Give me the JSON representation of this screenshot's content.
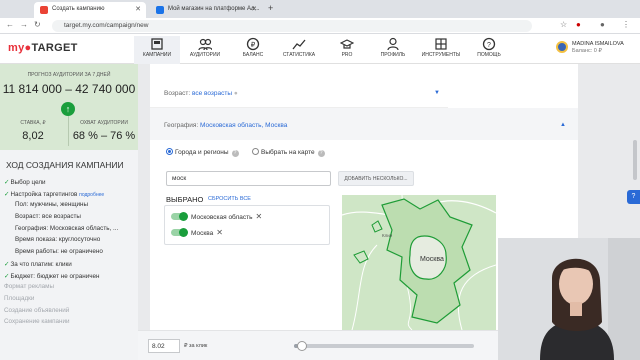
{
  "browser": {
    "tabs": [
      {
        "title": "Создать кампанию",
        "favicon_color": "#ea4335"
      },
      {
        "title": "Мой магазин на платформе Ал...",
        "favicon_color": "#1a73e8"
      }
    ],
    "new_tab": "+",
    "url": "target.my.com/campaign/new"
  },
  "app": {
    "logo_my": "my",
    "logo_target": "TARGET",
    "nav": [
      {
        "label": "КАМПАНИИ",
        "icon": "campaigns-icon",
        "active": true
      },
      {
        "label": "АУДИТОРИИ",
        "icon": "audiences-icon"
      },
      {
        "label": "БАЛАНС",
        "icon": "balance-icon"
      },
      {
        "label": "СТАТИСТИКА",
        "icon": "statistics-icon"
      },
      {
        "label": "PRO",
        "icon": "pro-icon"
      },
      {
        "label": "ПРОФИЛЬ",
        "icon": "profile-icon"
      },
      {
        "label": "ИНСТРУМЕНТЫ",
        "icon": "tools-icon"
      },
      {
        "label": "ПОМОЩЬ",
        "icon": "help-icon"
      }
    ],
    "user": {
      "name": "MADINA ISMAILOVA",
      "balance": "Баланс: 0 ₽"
    }
  },
  "forecast": {
    "heading": "ПРОГНОЗ АУДИТОРИИ ЗА 7 ДНЕЙ",
    "range": "11 814 000 – 42 740 000",
    "stavka_label": "СТАВКА, ₽",
    "stavka_value": "8,02",
    "ohvat_label": "ОХВАТ АУДИТОРИИ",
    "ohvat_value": "68 % – 76 %"
  },
  "steps": {
    "title": "ХОД СОЗДАНИЯ КАМПАНИИ",
    "items": [
      {
        "text": "Выбор цели",
        "done": true
      },
      {
        "text": "Настройка таргетингов",
        "done": true,
        "hint": "подробнее"
      },
      {
        "text": "Пол: мужчины, женщины",
        "sub": true
      },
      {
        "text": "Возраст: все возрасты",
        "sub": true
      },
      {
        "text": "География: Московская область, ...",
        "sub": true
      },
      {
        "text": "Время показа: круглосуточно",
        "sub": true
      },
      {
        "text": "Время работы: не ограничено",
        "sub": true
      },
      {
        "text": "За что платим: клики",
        "done": true
      },
      {
        "text": "Бюджет: бюджет не ограничен",
        "done": true
      },
      {
        "text": "Формат рекламы",
        "muted": true
      },
      {
        "text": "Площадки",
        "muted": true
      },
      {
        "text": "Создание объявлений",
        "muted": true
      },
      {
        "text": "Сохранение кампании",
        "muted": true
      }
    ]
  },
  "targeting": {
    "age_label": "Возраст:",
    "age_value": "все возрасты",
    "geo_label": "География:",
    "geo_value": "Московская область, Москва",
    "radio_regions": "Города и регионы",
    "radio_map": "Выбрать на карте",
    "search_value": "моск",
    "add_many": "ДОБАВИТЬ НЕСКОЛЬКО...",
    "selected_title": "ВЫБРАНО",
    "reset": "СБРОСИТЬ ВСЕ",
    "chips": [
      "Московская область",
      "Москва"
    ],
    "map_labels": [
      "Москва",
      "Клин"
    ],
    "zoom_in": "+",
    "zoom_out": "−"
  },
  "bottom": {
    "bid_value": "8.02",
    "bid_label": "₽ за клик",
    "slider_fraction": 0.02
  },
  "help_tab": "?"
}
